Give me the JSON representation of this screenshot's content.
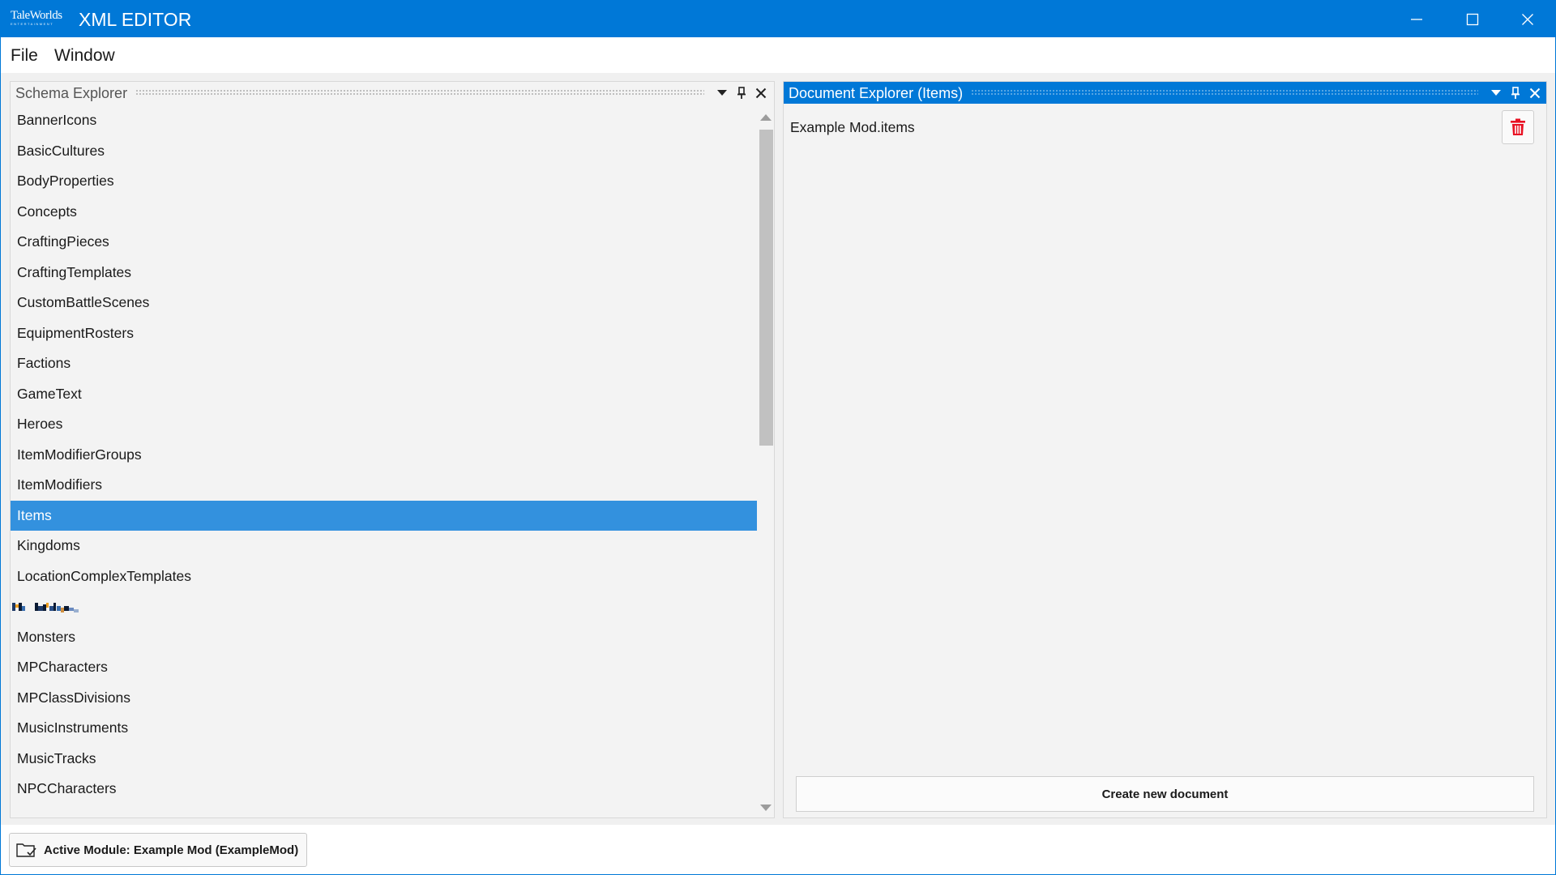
{
  "window": {
    "logo_text": "TaleWorlds",
    "logo_subtext": "ENTERTAINMENT",
    "title": "XML EDITOR",
    "controls": [
      "minimize-icon",
      "maximize-icon",
      "close-icon"
    ]
  },
  "menu": {
    "items": [
      "File",
      "Window"
    ]
  },
  "schema_explorer": {
    "title": "Schema Explorer",
    "header_icons": [
      "dropdown-arrow-icon",
      "pin-icon",
      "close-icon"
    ],
    "selected": "Items",
    "items": [
      "BannerIcons",
      "BasicCultures",
      "BodyProperties",
      "Concepts",
      "CraftingPieces",
      "CraftingTemplates",
      "CustomBattleScenes",
      "EquipmentRosters",
      "Factions",
      "GameText",
      "Heroes",
      "ItemModifierGroups",
      "ItemModifiers",
      "Items",
      "Kingdoms",
      "LocationComplexTemplates",
      "",
      "Monsters",
      "MPCharacters",
      "MPClassDivisions",
      "MusicInstruments",
      "MusicTracks",
      "NPCCharacters"
    ]
  },
  "document_explorer": {
    "title": "Document Explorer (Items)",
    "header_icons": [
      "dropdown-arrow-icon",
      "pin-icon",
      "close-icon"
    ],
    "documents": [
      "Example Mod.items"
    ],
    "create_button": "Create new document",
    "delete_icon": "trash-icon",
    "delete_color": "#e81123"
  },
  "status": {
    "active_module": "Active Module: Example Mod (ExampleMod)",
    "icon": "folder-check-icon"
  },
  "colors": {
    "accent": "#0078d7",
    "selection": "#3391de"
  }
}
